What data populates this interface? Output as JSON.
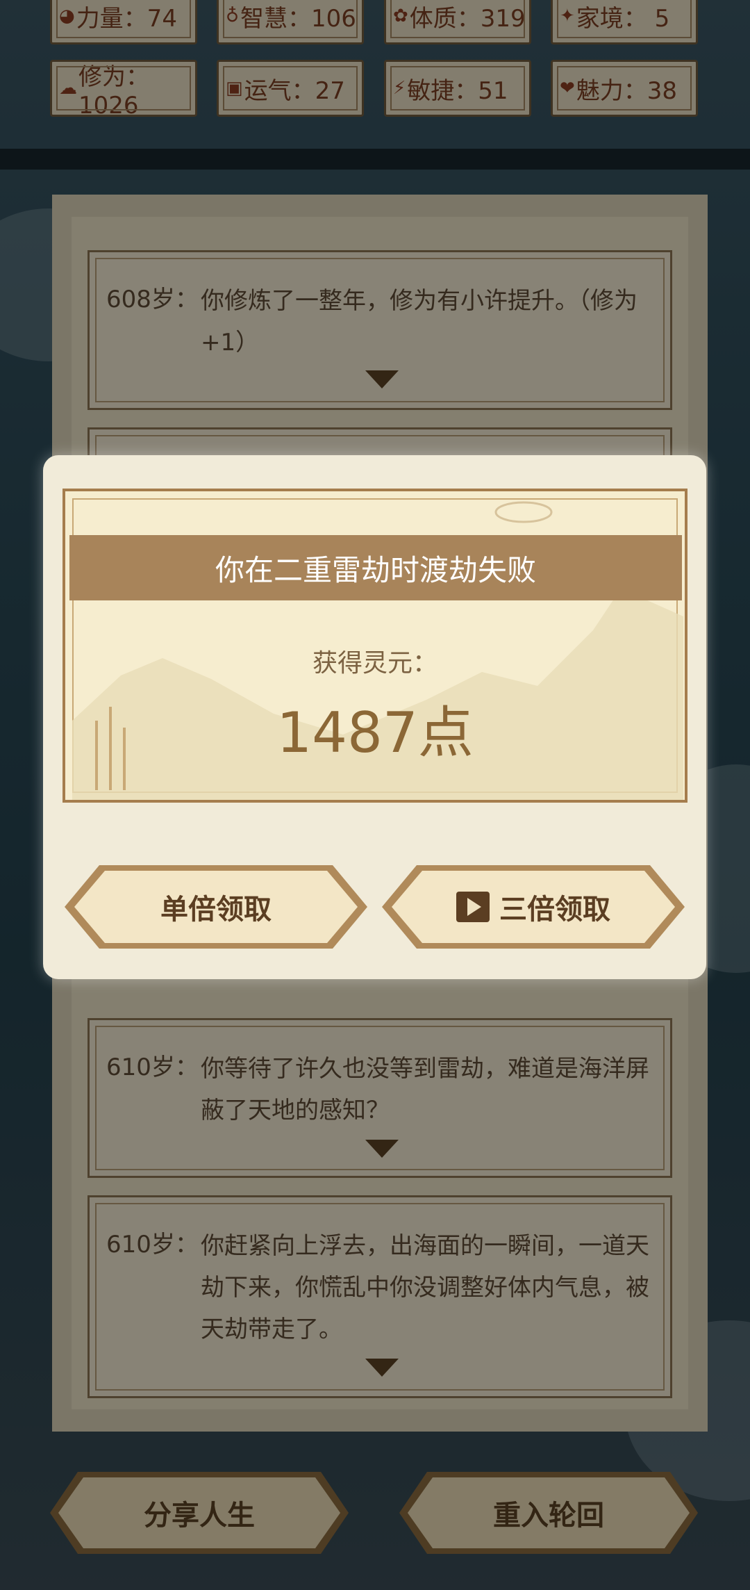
{
  "stats": [
    {
      "icon": "strength-icon",
      "label": "力量：74"
    },
    {
      "icon": "wisdom-icon",
      "label": "智慧：106"
    },
    {
      "icon": "constitution-icon",
      "label": "体质：319"
    },
    {
      "icon": "family-icon",
      "label": "家境： 5"
    },
    {
      "icon": "cultivation-icon",
      "label": "修为：1026"
    },
    {
      "icon": "luck-icon",
      "label": "运气：27"
    },
    {
      "icon": "agility-icon",
      "label": "敏捷：51"
    },
    {
      "icon": "charm-icon",
      "label": "魅力：38"
    }
  ],
  "log": [
    {
      "age": "608岁：",
      "text": "你修炼了一整年，修为有小许提升。（修为+1）"
    },
    {
      "age": "610岁：",
      "text": "你等待了许久也没等到雷劫，难道是海洋屏蔽了天地的感知？"
    },
    {
      "age": "610岁：",
      "text": "你赶紧向上浮去，出海面的一瞬间，一道天劫下来，你慌乱中你没调整好体内气息，被天劫带走了。"
    }
  ],
  "bottom_buttons": {
    "share": "分享人生",
    "rebirth": "重入轮回"
  },
  "modal": {
    "title": "你在二重雷劫时渡劫失败",
    "reward_label": "获得灵元：",
    "reward_value": "1487点",
    "single_button": "单倍领取",
    "triple_button": "三倍领取"
  },
  "colors": {
    "accent": "#a8845a",
    "text_brown": "#5d4a35",
    "modal_bg": "#f1ebd9"
  }
}
